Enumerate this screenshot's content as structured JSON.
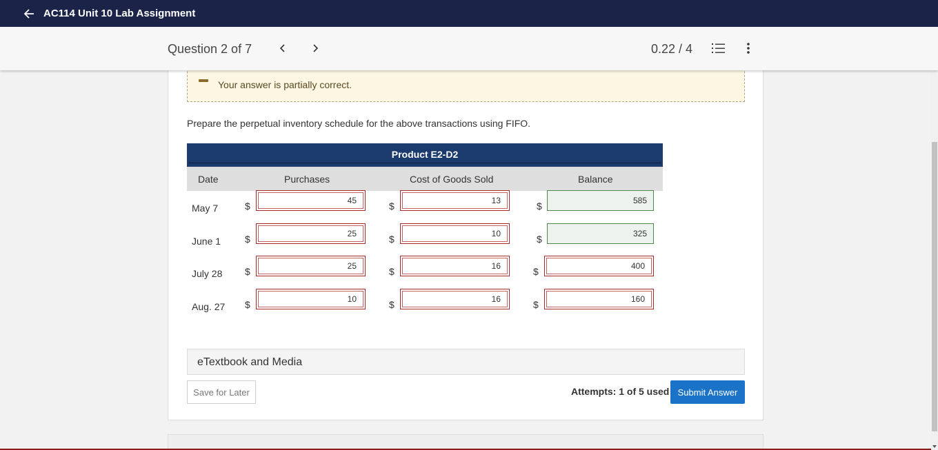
{
  "header": {
    "title": "AC114 Unit 10 Lab Assignment"
  },
  "question_bar": {
    "question_label": "Question 2 of 7",
    "score": "0.22 / 4"
  },
  "feedback": {
    "message": "Your answer is partially correct."
  },
  "prompt": "Prepare the perpetual inventory schedule for the above transactions using FIFO.",
  "table": {
    "title": "Product E2-D2",
    "columns": {
      "date": "Date",
      "purchases": "Purchases",
      "cogs": "Cost of Goods Sold",
      "balance": "Balance"
    },
    "currency": "$",
    "rows": [
      {
        "date": "May 7",
        "purchases": "45",
        "cogs": "13",
        "balance": "585"
      },
      {
        "date": "June 1",
        "purchases": "25",
        "cogs": "10",
        "balance": "325"
      },
      {
        "date": "July 28",
        "purchases": "25",
        "cogs": "16",
        "balance": "400"
      },
      {
        "date": "Aug. 27",
        "purchases": "10",
        "cogs": "16",
        "balance": "160"
      }
    ]
  },
  "etextbook": {
    "label": "eTextbook and Media"
  },
  "footer": {
    "save_label": "Save for Later",
    "attempts": "Attempts: 1 of 5 used",
    "submit_label": "Submit Answer"
  },
  "icons": {
    "back": "arrow-left-icon",
    "prev": "chevron-left-icon",
    "next": "chevron-right-icon",
    "list": "numbered-list-icon",
    "more": "more-vertical-icon"
  },
  "colors": {
    "topbar": "#1b2448",
    "table_header": "#1b3b6f",
    "submit": "#1a73c7",
    "incorrect_border": "#a82828",
    "correct_border": "#4d8b4d",
    "feedback_bg": "#fcf6e3"
  }
}
